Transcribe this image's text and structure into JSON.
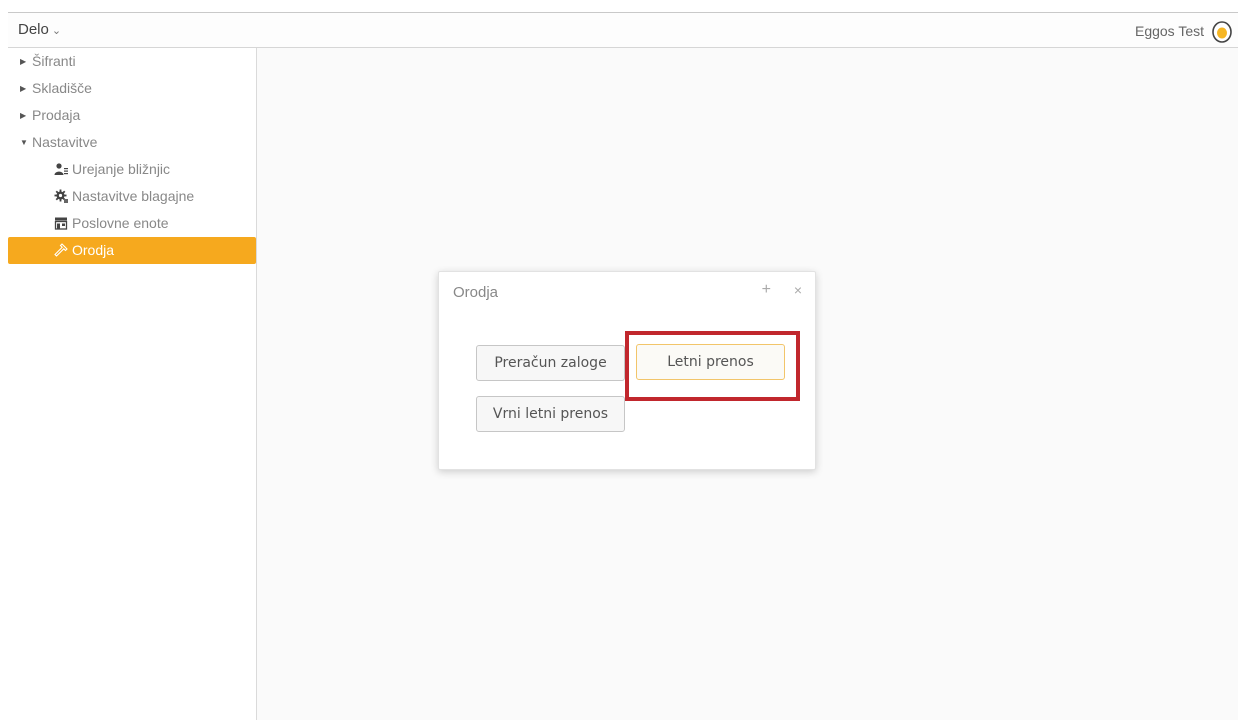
{
  "header": {
    "menu_label": "Delo",
    "menu_chevron": "⌄",
    "user_name": "Eggos Test",
    "avatar_icon": "egg-logo-icon",
    "accent_color": "#f6a91e"
  },
  "sidebar": {
    "items": [
      {
        "label": "Šifranti",
        "expanded": false
      },
      {
        "label": "Skladišče",
        "expanded": false
      },
      {
        "label": "Prodaja",
        "expanded": false
      },
      {
        "label": "Nastavitve",
        "expanded": true
      }
    ],
    "children": [
      {
        "label": "Urejanje bližnjic",
        "icon": "user-list-icon"
      },
      {
        "label": "Nastavitve blagajne",
        "icon": "gear-icon"
      },
      {
        "label": "Poslovne enote",
        "icon": "store-icon"
      },
      {
        "label": "Orodja",
        "icon": "hammer-icon",
        "active": true
      }
    ]
  },
  "dialog": {
    "title": "Orodja",
    "plus_symbol": "+",
    "close_symbol": "×",
    "buttons": {
      "recalc": "Preračun zaloge",
      "transfer": "Letni prenos",
      "revert": "Vrni letni prenos"
    },
    "highlight_color": "#c1272d"
  }
}
